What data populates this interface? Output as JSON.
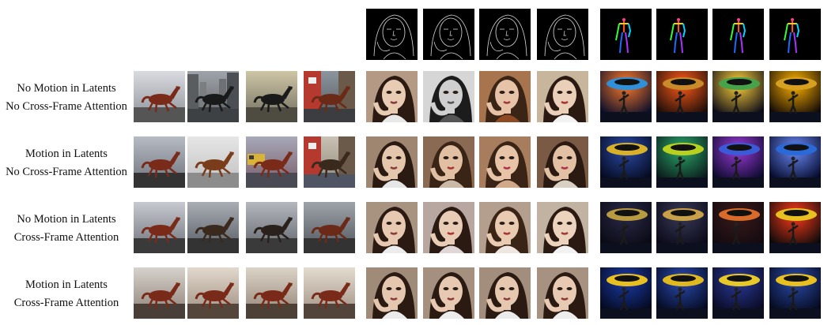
{
  "rows": [
    {
      "line1": "No Motion in Latents",
      "line2": "No Cross-Frame Attention"
    },
    {
      "line1": "Motion in Latents",
      "line2": "No Cross-Frame Attention"
    },
    {
      "line1": "No Motion in Latents",
      "line2": "Cross-Frame Attention"
    },
    {
      "line1": "Motion in Latents",
      "line2": "Cross-Frame Attention"
    }
  ],
  "columns": [
    {
      "name": "horse",
      "condition": null
    },
    {
      "name": "portrait",
      "condition": "edge-sketch"
    },
    {
      "name": "dancer",
      "condition": "pose-skeleton"
    }
  ]
}
